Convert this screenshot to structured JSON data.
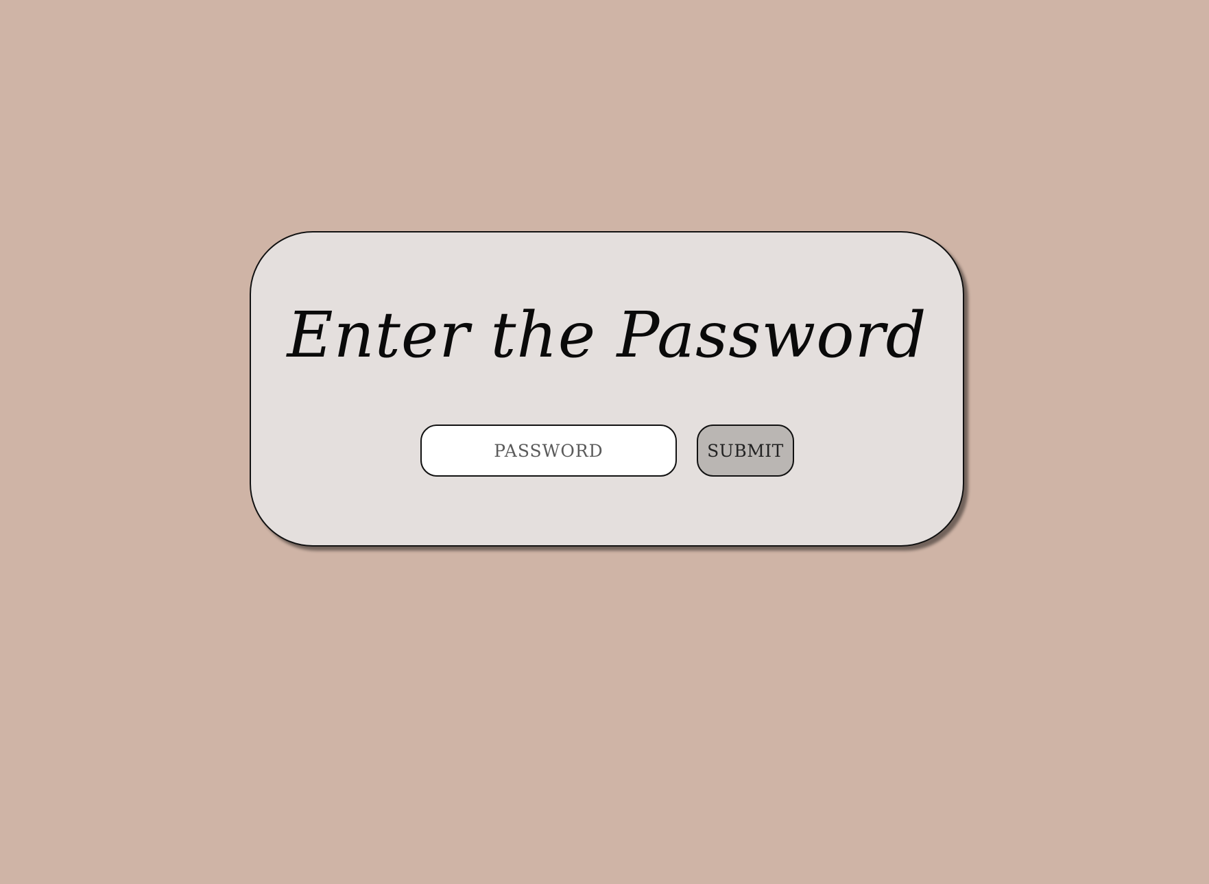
{
  "page": {
    "background_color": "#cfb4a6"
  },
  "card": {
    "title": "Enter the Password",
    "background_color": "#e4dfdd"
  },
  "form": {
    "password_placeholder": "PASSWORD",
    "password_value": "",
    "submit_label": "SUBMIT",
    "submit_color": "#bab6b3"
  }
}
